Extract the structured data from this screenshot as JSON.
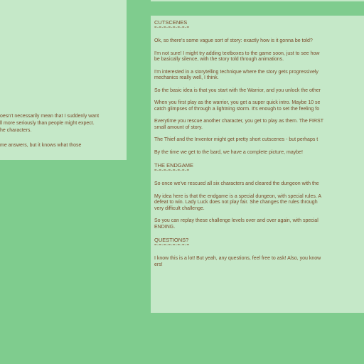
{
  "left_panel": {
    "lines": [
      "oesn't necessarily mean that I suddenly want",
      "ll more seriously than people might expect.",
      "he characters.",
      "me answers, but it knows what those"
    ]
  },
  "right_panel": {
    "sections": [
      {
        "heading": "CUTSCENES",
        "divider": "=-=-=-=-=-=-=-=",
        "paragraphs": [
          [
            "Ok, so there's some vague sort of story: exactly how is it gonna be told?"
          ],
          [
            "I'm not sure! I might try adding textboxes to the game soon, just to see how",
            "be basically silence, with the story told through animations."
          ],
          [
            "I'm interested in a storytelling technique where the story gets progressively",
            "mechanics really well, I think."
          ],
          [
            "So the basic idea is that you start with the Warrior, and you unlock the other"
          ],
          [
            "When you first play as the warrior, you get a super quick intro. Maybe 10 se",
            "catch glimpses of through a lightning storm. It's enough to set the feeling fo"
          ],
          [
            "Everytime you rescue another character, you get to play as them. The FIRST",
            "small amount of story."
          ],
          [
            "The Thief and the Inventor might get pretty short cutscenes - but perhaps t"
          ],
          [
            "By the time we get to the bard, we have a complete picture, maybe!"
          ]
        ]
      },
      {
        "heading": "THE ENDGAME",
        "divider": "=-=-=-=-=-=-=-=",
        "paragraphs": [
          [
            "So once we've rescued all six characters and cleared the dungeon with the"
          ],
          [
            "My idea here is that the endgame is a special dungeon, with special rules. A",
            "defeat to win. Lady Luck does not play fair. She changes the rules through",
            "very difficult challenge."
          ],
          [
            "So you can replay these challenge levels over and over again, with special",
            "ENDING."
          ]
        ]
      },
      {
        "heading": "QUESTIONS?",
        "divider": "=-=-=-=-=-=-=-=",
        "paragraphs": [
          [
            "I know this is a lot! But yeah, any questions, feel free to ask! Also, you know",
            "ers!"
          ]
        ]
      }
    ]
  }
}
